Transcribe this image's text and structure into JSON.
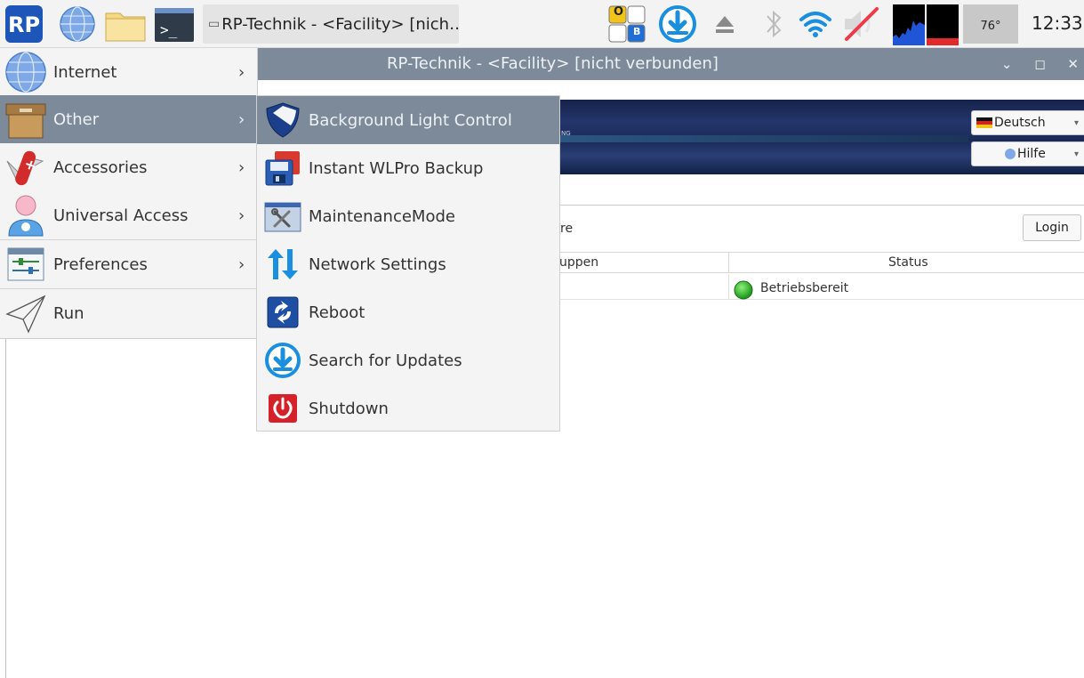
{
  "panel": {
    "taskbar_window_label": "RP-Technik - <Facility> [nich…",
    "keyboard_indicator": {
      "top_left": "O",
      "bottom_right": "B"
    },
    "temperature": "76°",
    "clock": "12:33"
  },
  "window": {
    "title": "RP-Technik - <Facility> [nicht verbunden]",
    "controls": "⌄ ◻ ✕",
    "banner_text": "NG",
    "language_select": "Deutsch",
    "help_select": "Hilfe",
    "section_label": "re",
    "login_button": "Login",
    "table": {
      "headers": [
        "uppen",
        "Status"
      ],
      "rows": [
        {
          "status": "Betriebsbereit"
        }
      ]
    }
  },
  "menu": {
    "items": [
      {
        "label": "Internet",
        "icon": "globe-icon",
        "submenu": true
      },
      {
        "label": "Other",
        "icon": "box-icon",
        "submenu": true,
        "selected": true
      },
      {
        "label": "Accessories",
        "icon": "pocket-knife-icon",
        "submenu": true
      },
      {
        "label": "Universal Access",
        "icon": "person-icon",
        "submenu": true
      },
      {
        "label": "Preferences",
        "icon": "sliders-icon",
        "submenu": true
      },
      {
        "label": "Run",
        "icon": "paper-plane-icon",
        "submenu": false
      }
    ],
    "chevron": "›"
  },
  "submenu": {
    "items": [
      {
        "label": "Background Light Control",
        "icon": "shield-icon",
        "selected": true
      },
      {
        "label": "Instant WLPro Backup",
        "icon": "floppy-disk-icon"
      },
      {
        "label": "MaintenanceMode",
        "icon": "tools-icon"
      },
      {
        "label": "Network Settings",
        "icon": "up-down-arrows-icon"
      },
      {
        "label": "Reboot",
        "icon": "reboot-icon"
      },
      {
        "label": "Search for Updates",
        "icon": "download-circle-icon"
      },
      {
        "label": "Shutdown",
        "icon": "power-icon"
      }
    ]
  },
  "colors": {
    "selection": "#7c8a99",
    "accent_blue": "#1a8fe0",
    "status_ok": "#2fb52a",
    "shutdown_red": "#d4212a"
  }
}
